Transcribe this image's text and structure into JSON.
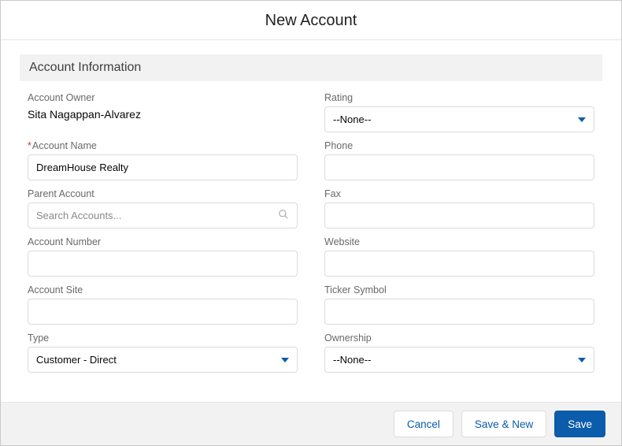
{
  "modal_title": "New Account",
  "section_title": "Account Information",
  "fields": {
    "owner_label": "Account Owner",
    "owner_value": "Sita Nagappan-Alvarez",
    "rating_label": "Rating",
    "rating_value": "--None--",
    "name_label": "Account Name",
    "name_value": "DreamHouse Realty",
    "phone_label": "Phone",
    "phone_value": "",
    "parent_label": "Parent Account",
    "parent_placeholder": "Search Accounts...",
    "fax_label": "Fax",
    "fax_value": "",
    "number_label": "Account Number",
    "number_value": "",
    "website_label": "Website",
    "website_value": "",
    "site_label": "Account Site",
    "site_value": "",
    "ticker_label": "Ticker Symbol",
    "ticker_value": "",
    "type_label": "Type",
    "type_value": "Customer - Direct",
    "ownership_label": "Ownership",
    "ownership_value": "--None--"
  },
  "footer": {
    "cancel": "Cancel",
    "savenew": "Save & New",
    "save": "Save"
  }
}
